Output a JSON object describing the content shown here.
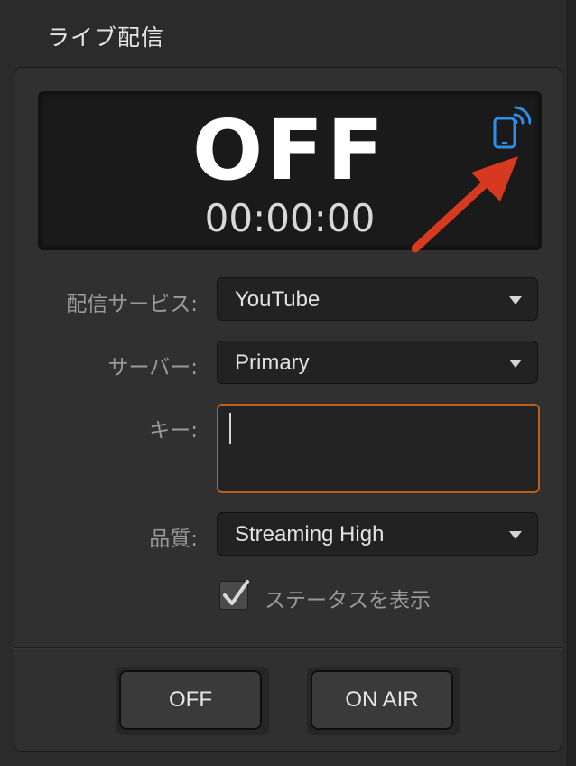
{
  "section": {
    "title": "ライブ配信"
  },
  "status": {
    "state": "OFF",
    "timer": "00:00:00",
    "state_color": "#ffffff"
  },
  "icons": {
    "phone": "smartphone-wireless-icon",
    "arrow": "red-arrow-annotation"
  },
  "colors": {
    "accent_focus": "#b8621b",
    "phone_icon": "#2f8fe6",
    "arrow": "#d6391f"
  },
  "form": {
    "service": {
      "label": "配信サービス:",
      "value": "YouTube"
    },
    "server": {
      "label": "サーバー:",
      "value": "Primary"
    },
    "key": {
      "label": "キー:",
      "value": ""
    },
    "quality": {
      "label": "品質:",
      "value": "Streaming High"
    },
    "show_status": {
      "label": "ステータスを表示",
      "checked": true
    }
  },
  "buttons": {
    "off_label": "OFF",
    "on_air_label": "ON AIR"
  }
}
